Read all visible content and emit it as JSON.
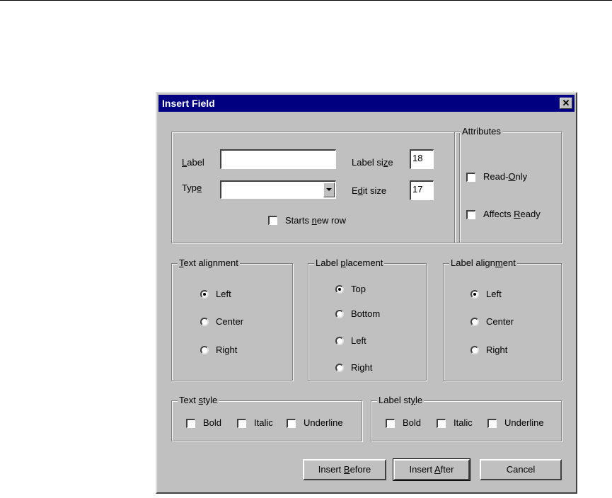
{
  "dialog": {
    "title": "Insert Field",
    "close_glyph": "✕"
  },
  "fields": {
    "label": {
      "text_pre": "",
      "text_u": "L",
      "text_post": "abel",
      "value": ""
    },
    "type": {
      "text_pre": "Typ",
      "text_u": "e",
      "text_post": "",
      "value": ""
    },
    "label_size": {
      "text_pre": "Label si",
      "text_u": "z",
      "text_post": "e",
      "value": "18"
    },
    "edit_size": {
      "text_pre": "E",
      "text_u": "d",
      "text_post": "it size",
      "value": "17"
    },
    "starts_new_row": {
      "text_pre": "Starts ",
      "text_u": "n",
      "text_post": "ew row",
      "checked": false
    }
  },
  "attributes": {
    "legend": "Attributes",
    "read_only": {
      "text_pre": "Read-",
      "text_u": "O",
      "text_post": "nly",
      "checked": false
    },
    "affects_ready": {
      "text_pre": "Affects ",
      "text_u": "R",
      "text_post": "eady",
      "checked": false
    }
  },
  "text_alignment": {
    "legend_pre": "",
    "legend_u": "T",
    "legend_post": "ext alignment",
    "options": [
      "Left",
      "Center",
      "Right"
    ],
    "selected": "Left"
  },
  "label_placement": {
    "legend_pre": "Label ",
    "legend_u": "p",
    "legend_post": "lacement",
    "options": [
      "Top",
      "Bottom",
      "Left",
      "Right"
    ],
    "selected": "Top"
  },
  "label_alignment": {
    "legend_pre": "Label align",
    "legend_u": "m",
    "legend_post": "ent",
    "options": [
      "Left",
      "Center",
      "Right"
    ],
    "selected": "Left"
  },
  "text_style": {
    "legend_pre": "Text ",
    "legend_u": "s",
    "legend_post": "tyle",
    "options": [
      "Bold",
      "Italic",
      "Underline"
    ]
  },
  "label_style": {
    "legend_pre": "Label st",
    "legend_u": "y",
    "legend_post": "le",
    "options": [
      "Bold",
      "Italic",
      "Underline"
    ]
  },
  "buttons": {
    "insert_before": {
      "pre": "Insert ",
      "u": "B",
      "post": "efore"
    },
    "insert_after": {
      "pre": "Insert ",
      "u": "A",
      "post": "fter"
    },
    "cancel": "Cancel"
  }
}
